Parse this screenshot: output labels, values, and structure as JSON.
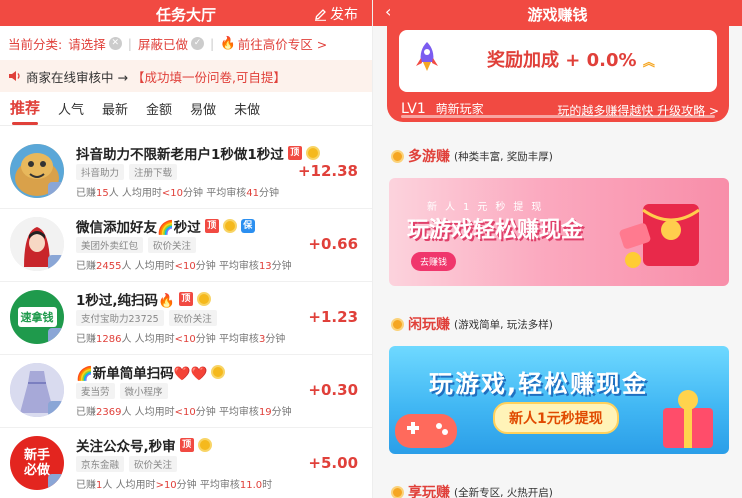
{
  "left": {
    "title": "任务大厅",
    "publish_label": "发布",
    "filters": {
      "category_label": "当前分类:",
      "category_value": "请选择",
      "hide_done": "屏蔽已做",
      "high_price": "前往高价专区 >"
    },
    "notice": {
      "online_text": "商家在线审核中 →",
      "promo_text": "【成功填一份问卷,可自提】"
    },
    "tabs": [
      "推荐",
      "人气",
      "最新",
      "金额",
      "易做",
      "未做"
    ],
    "tasks": [
      {
        "title": "抖音助力不限新老用户1秒做1秒过",
        "ding": "顶",
        "tags": [
          "抖音助力",
          "注册下载"
        ],
        "done_prefix": "已赚",
        "done_count": "15",
        "done_suffix": "人",
        "avg_prefix": "人均用时",
        "avg_value": "<10",
        "avg_unit": "分钟",
        "review_prefix": "平均审核",
        "review_value": "41",
        "review_unit": "分钟",
        "price": "+12.38",
        "thumb_color": "#f1c07a"
      },
      {
        "title": "微信添加好友🌈秒过",
        "ding": "顶",
        "bao": "保",
        "tags": [
          "美团外卖红包",
          "砍价关注"
        ],
        "done_prefix": "已赚",
        "done_count": "2455",
        "done_suffix": "人",
        "avg_prefix": "人均用时",
        "avg_value": "<10",
        "avg_unit": "分钟",
        "review_prefix": "平均审核",
        "review_value": "13",
        "review_unit": "分钟",
        "price": "+0.66",
        "thumb_color": "#e8e8e8"
      },
      {
        "title": "1秒过,纯扫码🔥",
        "ding": "顶",
        "tags": [
          "支付宝助力23725",
          "砍价关注"
        ],
        "done_prefix": "已赚",
        "done_count": "1286",
        "done_suffix": "人",
        "avg_prefix": "人均用时",
        "avg_value": "<10",
        "avg_unit": "分钟",
        "review_prefix": "平均审核",
        "review_value": "3",
        "review_unit": "分钟",
        "price": "+1.23",
        "thumb_text": "速拿钱",
        "thumb_color": "#1f9a4c"
      },
      {
        "title": "🌈新单简单扫码❤️❤️",
        "ding": "顶",
        "tags": [
          "麦当劳",
          "微小程序"
        ],
        "done_prefix": "已赚",
        "done_count": "2369",
        "done_suffix": "人",
        "avg_prefix": "人均用时",
        "avg_value": "<10",
        "avg_unit": "分钟",
        "review_prefix": "平均审核",
        "review_value": "19",
        "review_unit": "分钟",
        "price": "+0.30",
        "thumb_color": "#c7c9e8"
      },
      {
        "title": "关注公众号,秒审",
        "ding": "顶",
        "tags": [
          "京东金融",
          "砍价关注"
        ],
        "done_prefix": "已赚",
        "done_count": "1",
        "done_suffix": "人",
        "avg_prefix": "人均用时",
        "avg_value": ">10",
        "avg_unit": "分钟",
        "review_prefix": "平均审核",
        "review_value": "11.0",
        "review_unit": "时",
        "price": "+5.00",
        "thumb_text": "新手必做",
        "thumb_color": "#e3251f"
      }
    ]
  },
  "right": {
    "title": "游戏赚钱",
    "back_icon": "chevron-left-icon",
    "bonus_text": "奖励加成 + 0.0%",
    "level": "LV1",
    "level_name": "萌新玩家",
    "tip": "玩的越多赚得越快 升级攻略 >",
    "sections": [
      {
        "name": "多游赚",
        "desc": "(种类丰富, 奖励丰厚)"
      },
      {
        "name": "闲玩赚",
        "desc": "(游戏简单, 玩法多样)"
      },
      {
        "name": "享玩赚",
        "desc": "(全新专区, 火热开启)"
      }
    ],
    "banner1": {
      "small": "新人1元秒提现",
      "big": "玩游戏轻松赚现金",
      "button": "去赚钱"
    },
    "banner2": {
      "big": "玩游戏,轻松赚现金",
      "pill": "新人1元秒提现"
    }
  },
  "colors": {
    "brand_red": "#f14a42",
    "price_red": "#e0403a"
  }
}
